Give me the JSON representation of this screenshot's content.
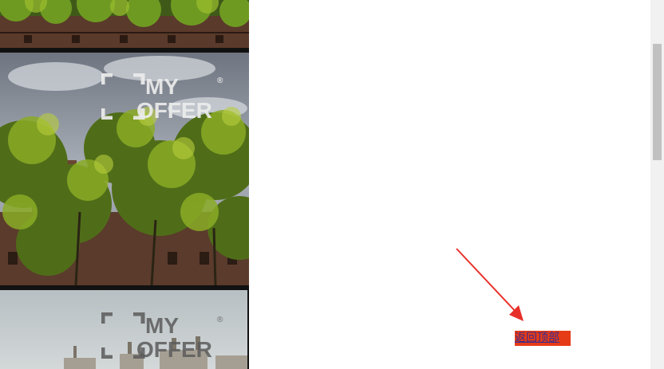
{
  "photos": [
    {
      "name": "campus-photo-top",
      "watermark": ""
    },
    {
      "name": "campus-photo-trees",
      "watermark": "MY OFFER"
    },
    {
      "name": "campus-photo-buildings",
      "watermark": "MY OFFER"
    }
  ],
  "watermark": {
    "line1": "MY",
    "line2": "OFFER",
    "mark": "®"
  },
  "back_to_top": {
    "label": "返回顶部"
  },
  "colors": {
    "back_to_top_bg": "#e53b16",
    "back_to_top_text": "#3b2b8f",
    "arrow": "#e8302a"
  }
}
